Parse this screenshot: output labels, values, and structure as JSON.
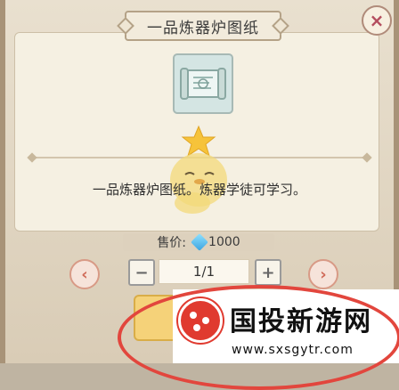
{
  "dialog": {
    "title": "一品炼器炉图纸",
    "close_glyph": "×",
    "item_icon": "scroll-icon",
    "description": "一品炼器炉图纸。炼器学徒可学习。",
    "price_label": "售价:",
    "price_value": "1000",
    "currency_icon": "gem-icon",
    "quantity": "1/1",
    "minus_glyph": "−",
    "plus_glyph": "+",
    "prev_glyph": "‹",
    "next_glyph": "›"
  },
  "watermark": {
    "title": "国投新游网",
    "url": "www.sxsgytr.com"
  },
  "colors": {
    "accent_red": "#e2463d",
    "button_gold": "#f5d279",
    "frame_brown": "#a89378"
  }
}
